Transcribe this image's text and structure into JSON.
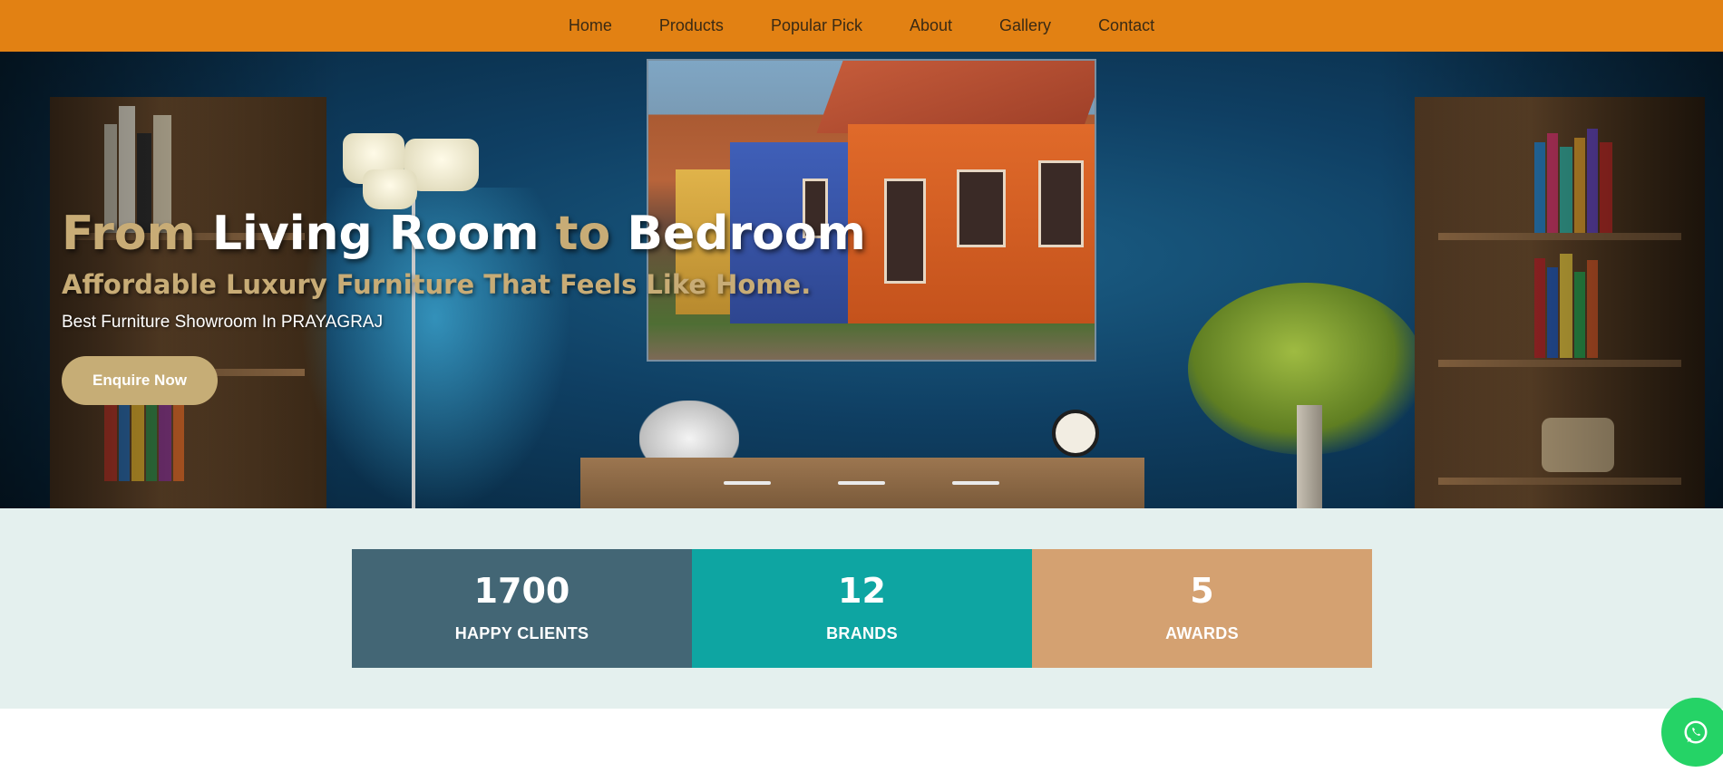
{
  "nav": {
    "items": [
      {
        "label": "Home"
      },
      {
        "label": "Products"
      },
      {
        "label": "Popular Pick"
      },
      {
        "label": "About"
      },
      {
        "label": "Gallery"
      },
      {
        "label": "Contact"
      }
    ]
  },
  "hero": {
    "headline": {
      "part1": "From",
      "part2": "Living Room",
      "part3": "to",
      "part4": "Bedroom"
    },
    "subline": "Affordable Luxury Furniture That Feels Like Home.",
    "tagline": "Best Furniture Showroom In PRAYAGRAJ",
    "cta_label": "Enquire Now"
  },
  "stats": [
    {
      "value": "1700",
      "label": "HAPPY CLIENTS",
      "color": "#436675"
    },
    {
      "value": "12",
      "label": "BRANDS",
      "color": "#0ea5a2"
    },
    {
      "value": "5",
      "label": "AWARDS",
      "color": "#d4a171"
    }
  ],
  "colors": {
    "nav_bg": "#e28113",
    "accent_gold": "#c8ac76",
    "stats_band": "#e4f0ee",
    "whatsapp": "#25d366"
  },
  "whatsapp": {
    "icon": "whatsapp-icon"
  }
}
